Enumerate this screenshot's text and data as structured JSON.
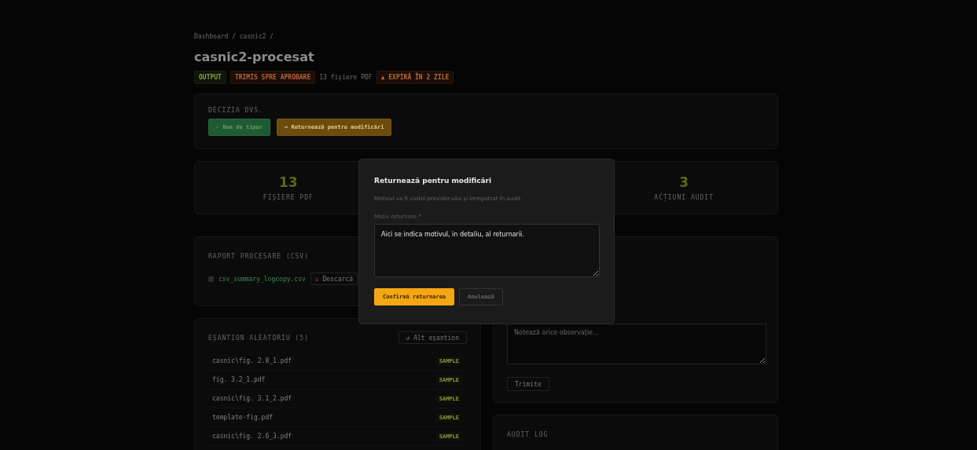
{
  "breadcrumb": "Dashboard / casnic2 /",
  "title": "casnic2-procesat",
  "badges": [
    {
      "label": "OUTPUT",
      "kind": "type"
    },
    {
      "label": "TRIMIS SPRE APROBARE",
      "kind": "status"
    },
    {
      "label": "13 fișiere PDF",
      "kind": "plain"
    },
    {
      "label": "▲ EXPIRĂ ÎN 2 ZILE",
      "kind": "warning"
    }
  ],
  "decision": {
    "heading": "DECIZIA DVS.",
    "buttons": [
      {
        "label": "✓ Bun de tipar",
        "kind": "approve"
      },
      {
        "label": "↩ Returnează pentru modificări",
        "kind": "return"
      }
    ]
  },
  "stats": [
    {
      "value": "13",
      "label": "FIȘIERE PDF"
    },
    {
      "value": "3",
      "label": "ACȚIUNI AUDIT"
    }
  ],
  "csv_report": {
    "heading": "RAPORT PROCESARE (CSV)",
    "file": "csv_summary_logcopy.csv",
    "download": "↓ Descarcă"
  },
  "sample": {
    "heading": "EȘANTION ALEATORIU (5)",
    "reshuffle": "↺ Alt eșantion",
    "files": [
      {
        "name": "casnic\\fig. 2.8_1.pdf",
        "tag": "SAMPLE"
      },
      {
        "name": "fig. 3.2_1.pdf",
        "tag": "SAMPLE"
      },
      {
        "name": "casnic\\fig. 3.1_2.pdf",
        "tag": "SAMPLE"
      },
      {
        "name": "template-fig.pdf",
        "tag": "SAMPLE"
      },
      {
        "name": "casnic\\fig. 2.6_3.pdf",
        "tag": "SAMPLE"
      }
    ]
  },
  "notes": {
    "placeholder": "Notează orice observație...",
    "submit": "Trimite"
  },
  "audit": {
    "heading": "AUDIT LOG"
  },
  "modal": {
    "title": "Returnează pentru modificări",
    "description": "Motivul va fi vizibil provider-ului și înregistrat în audit.",
    "field_label": "Motiv returnare *",
    "value": "Aici se indica motivul, in detaliu, al returnarii.",
    "confirm": "Confirmă returnarea",
    "cancel": "Anulează"
  }
}
